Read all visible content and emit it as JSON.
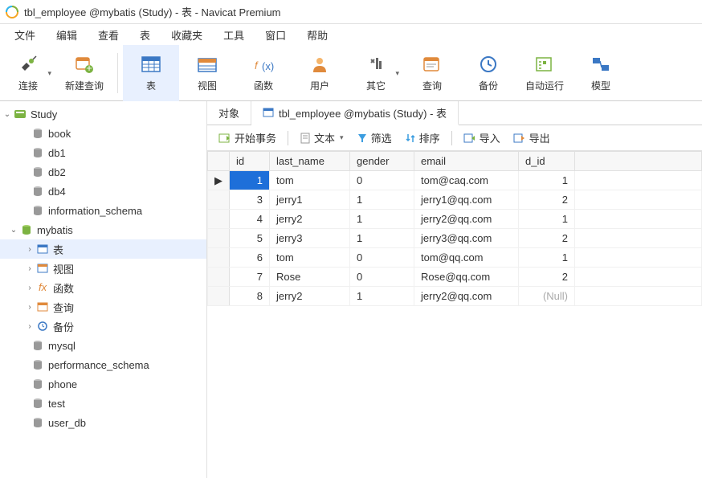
{
  "window": {
    "title": "tbl_employee @mybatis (Study) - 表 - Navicat Premium"
  },
  "menu": {
    "items": [
      "文件",
      "编辑",
      "查看",
      "表",
      "收藏夹",
      "工具",
      "窗口",
      "帮助"
    ]
  },
  "toolbar": {
    "connect": "连接",
    "newquery": "新建查询",
    "table": "表",
    "view": "视图",
    "function": "函数",
    "user": "用户",
    "other": "其它",
    "query": "查询",
    "backup": "备份",
    "autorun": "自动运行",
    "model": "模型"
  },
  "sidebar": {
    "conn": "Study",
    "dbs": {
      "book": "book",
      "db1": "db1",
      "db2": "db2",
      "db4": "db4",
      "information_schema": "information_schema",
      "mybatis": "mybatis",
      "mysql": "mysql",
      "performance_schema": "performance_schema",
      "phone": "phone",
      "test": "test",
      "user_db": "user_db"
    },
    "mybatis_children": {
      "tables": "表",
      "views": "视图",
      "functions": "函数",
      "queries": "查询",
      "backups": "备份"
    }
  },
  "tabs": {
    "objects": "对象",
    "tableTab": "tbl_employee @mybatis (Study) - 表"
  },
  "localbar": {
    "begin": "开始事务",
    "text": "文本",
    "filter": "筛选",
    "sort": "排序",
    "import": "导入",
    "export": "导出"
  },
  "grid": {
    "headers": {
      "id": "id",
      "last_name": "last_name",
      "gender": "gender",
      "email": "email",
      "d_id": "d_id"
    },
    "rows": [
      {
        "id": "1",
        "last_name": "tom",
        "gender": "0",
        "email": "tom@caq.com",
        "d_id": "1",
        "current": true
      },
      {
        "id": "3",
        "last_name": "jerry1",
        "gender": "1",
        "email": "jerry1@qq.com",
        "d_id": "2"
      },
      {
        "id": "4",
        "last_name": "jerry2",
        "gender": "1",
        "email": "jerry2@qq.com",
        "d_id": "1"
      },
      {
        "id": "5",
        "last_name": "jerry3",
        "gender": "1",
        "email": "jerry3@qq.com",
        "d_id": "2"
      },
      {
        "id": "6",
        "last_name": "tom",
        "gender": "0",
        "email": "tom@qq.com",
        "d_id": "1"
      },
      {
        "id": "7",
        "last_name": "Rose",
        "gender": "0",
        "email": "Rose@qq.com",
        "d_id": "2"
      },
      {
        "id": "8",
        "last_name": "jerry2",
        "gender": "1",
        "email": "jerry2@qq.com",
        "d_id": "(Null)",
        "null_d_id": true
      }
    ]
  }
}
